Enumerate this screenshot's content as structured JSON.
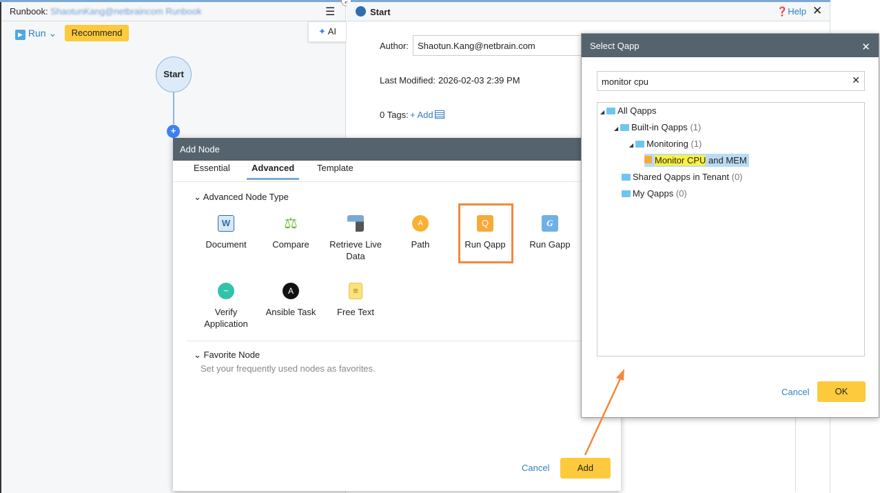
{
  "left_panel": {
    "runbook_label": "Runbook:",
    "runbook_name": "ShaotunKang@netbraincom Runbook",
    "run_label": "Run",
    "recommend_label": "Recommend",
    "ai_label": "AI",
    "start_node": "Start"
  },
  "right_panel": {
    "title": "Start",
    "help_label": "Help",
    "author_label": "Author:",
    "author_value": "Shaotun.Kang@netbrain.com",
    "last_modified_label": "Last Modified:",
    "last_modified_value": "2026-02-03 2:39 PM",
    "tags_label": "0 Tags:",
    "add_tag_label": "+ Add"
  },
  "add_node": {
    "title": "Add Node",
    "tabs": [
      {
        "label": "Essential"
      },
      {
        "label": "Advanced",
        "active": true
      },
      {
        "label": "Template"
      }
    ],
    "section_advanced": "Advanced Node Type",
    "items": [
      {
        "label": "Document",
        "icon": "word-document-icon"
      },
      {
        "label": "Compare",
        "icon": "scale-icon"
      },
      {
        "label": "Retrieve Live Data",
        "icon": "database-icon"
      },
      {
        "label": "Path",
        "icon": "path-icon"
      },
      {
        "label": "Run Qapp",
        "icon": "qapp-icon"
      },
      {
        "label": "Run Gapp",
        "icon": "gapp-icon"
      },
      {
        "label": "Verify Application",
        "icon": "wave-icon"
      },
      {
        "label": "Ansible Task",
        "icon": "ansible-icon"
      },
      {
        "label": "Free Text",
        "icon": "note-icon"
      }
    ],
    "section_favorite": "Favorite Node",
    "favorite_hint": "Set your frequently used nodes as favorites.",
    "cancel_label": "Cancel",
    "add_label": "Add"
  },
  "select_qapp": {
    "title": "Select Qapp",
    "search_value": "monitor cpu",
    "tree": {
      "root": "All Qapps",
      "builtin": "Built-in Qapps",
      "builtin_count": "(1)",
      "monitoring": "Monitoring",
      "monitoring_count": "(1)",
      "qapp_highlight": "Monitor CPU",
      "qapp_rest": " and MEM",
      "shared": "Shared Qapps in Tenant",
      "shared_count": "(0)",
      "my": "My Qapps",
      "my_count": "(0)"
    },
    "cancel_label": "Cancel",
    "ok_label": "OK"
  },
  "colors": {
    "accent_orange": "#f5873a",
    "button_yellow": "#fdc93d",
    "header_dark": "#55636e",
    "link_blue": "#2f7fc1"
  }
}
